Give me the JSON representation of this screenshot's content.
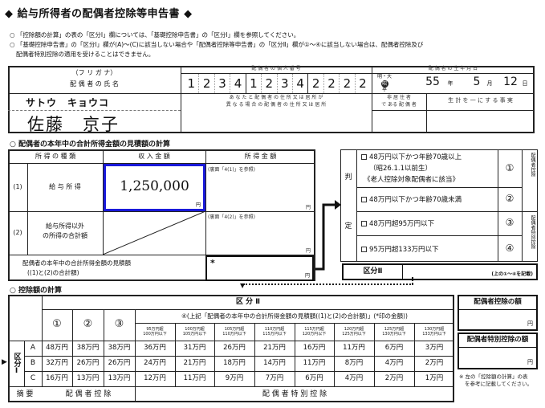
{
  "title": "給与所得者の配偶者控除等申告書",
  "notes": [
    "○ 「控除額の計算」の表の「区分Ⅰ」欄については、「基礎控除申告書」の「区分Ⅰ」欄を参照してください。",
    "○ 「基礎控除申告書」の「区分Ⅰ」欄が(A)～(C)に該当しない場合や「配偶者控除等申告書」の「区分Ⅱ」欄が①～④に該当しない場合は、配偶者控除及び",
    "配偶者特別控除の適用を受けることはできません。"
  ],
  "spouse": {
    "furigana_label": "（フ リ ガ ナ）",
    "name_label": "配 偶 者 の 氏 名",
    "furigana": "サトウ　キョウコ",
    "name": "佐藤　京子",
    "mynumber_label": "配 偶 者 の 個 人 番 号",
    "mynumber_digits": [
      "1",
      "2",
      "3",
      "4",
      "1",
      "2",
      "3",
      "4",
      "2",
      "2",
      "2",
      "2"
    ],
    "birth_label": "配 偶 者 の 生 年 月 日",
    "era_top": "明・大",
    "era_selected": "昭",
    "era_bottom": "平",
    "birth_year": "55",
    "birth_month": "5",
    "birth_day": "12",
    "year_unit": "年",
    "month_unit": "月",
    "day_unit": "日",
    "address_label_1": "あ な た と 配 偶 者 の 住 所 又 は 居 所 が",
    "address_label_2": "異 な る 場 合 の 配 偶 者 の 住 所 又 は 居 所",
    "nonresident_label_1": "非 居 住 者",
    "nonresident_label_2": "で ある 配 偶 者",
    "livelihood_label": "生 計 を 一 に す る 事 実"
  },
  "income": {
    "section_title": "○ 配偶者の本年中の合計所得金額の見積額の計算",
    "col_type": "所 得 の 種 類",
    "col_revenue": "収 入 金 額",
    "col_income": "所 得 金 額",
    "row1_num": "(1)",
    "row1_label": "給 与 所 得",
    "row1_revenue": "1,250,000",
    "row1_ref": "(裏面「4(1)」を参照)",
    "row2_num": "(2)",
    "row2_label_1": "給与所得以外",
    "row2_label_2": "の所得の合計額",
    "row2_ref": "(裏面「4(2)」を参照)",
    "total_label_1": "配偶者の本年中の合計所得金額の見積額",
    "total_label_2": "((1)と(2)の合計額)",
    "total_mark": "*",
    "yen": "円"
  },
  "judgement": {
    "side_label_1": "判",
    "side_label_2": "定",
    "options": [
      {
        "line1": "48万円以下かつ年齢70歳以上",
        "line2": "（昭26.1.1以前生）",
        "line3": "《老人控除対象配偶者に該当》",
        "num": "①"
      },
      {
        "line1": "48万円以下かつ年齢70歳未満",
        "num": "②"
      },
      {
        "line1": "48万円超95万円以下",
        "num": "③"
      },
      {
        "line1": "95万円超133万円以下",
        "num": "④"
      }
    ],
    "side_right_top": "配偶者控除",
    "side_right_bottom": "配偶者特別控除",
    "kubun2_label": "区分Ⅱ",
    "kubun2_note": "(上の①～④を記載)"
  },
  "deduction": {
    "section_title": "○ 控除額の計算",
    "kubun2_header": "区 分 Ⅱ",
    "col_1": "①",
    "col_2": "②",
    "col_3": "③",
    "col_4_header": "④(上記「配偶者の本年中の合計所得金額の見積額((1)と(2)の合計額)」(*印の金額))",
    "sub_ranges": [
      [
        "95万円超",
        "100万円以下"
      ],
      [
        "100万円超",
        "105万円以下"
      ],
      [
        "105万円超",
        "110万円以下"
      ],
      [
        "110万円超",
        "115万円以下"
      ],
      [
        "115万円超",
        "120万円以下"
      ],
      [
        "120万円超",
        "125万円以下"
      ],
      [
        "125万円超",
        "130万円以下"
      ],
      [
        "130万円超",
        "133万円以下"
      ]
    ],
    "kubun1_label": "区分Ⅰ",
    "rows": [
      {
        "key": "A",
        "values": [
          "48万円",
          "38万円",
          "38万円",
          "36万円",
          "31万円",
          "26万円",
          "21万円",
          "16万円",
          "11万円",
          "6万円",
          "3万円"
        ]
      },
      {
        "key": "B",
        "values": [
          "32万円",
          "26万円",
          "26万円",
          "24万円",
          "21万円",
          "18万円",
          "14万円",
          "11万円",
          "8万円",
          "4万円",
          "2万円"
        ]
      },
      {
        "key": "C",
        "values": [
          "16万円",
          "13万円",
          "13万円",
          "12万円",
          "11万円",
          "9万円",
          "7万円",
          "6万円",
          "4万円",
          "2万円",
          "1万円"
        ]
      }
    ],
    "summary_label": "摘 要",
    "summary_spouse": "配 偶 者 控 除",
    "summary_special": "配 偶 者 特 別 控 除",
    "amount_label_1": "配偶者控除の額",
    "amount_label_2": "配偶者特別控除の額",
    "yen": "円",
    "footnote_1": "※ 左の「控除額の計算」の表",
    "footnote_2": "を参考に記載してください。"
  }
}
